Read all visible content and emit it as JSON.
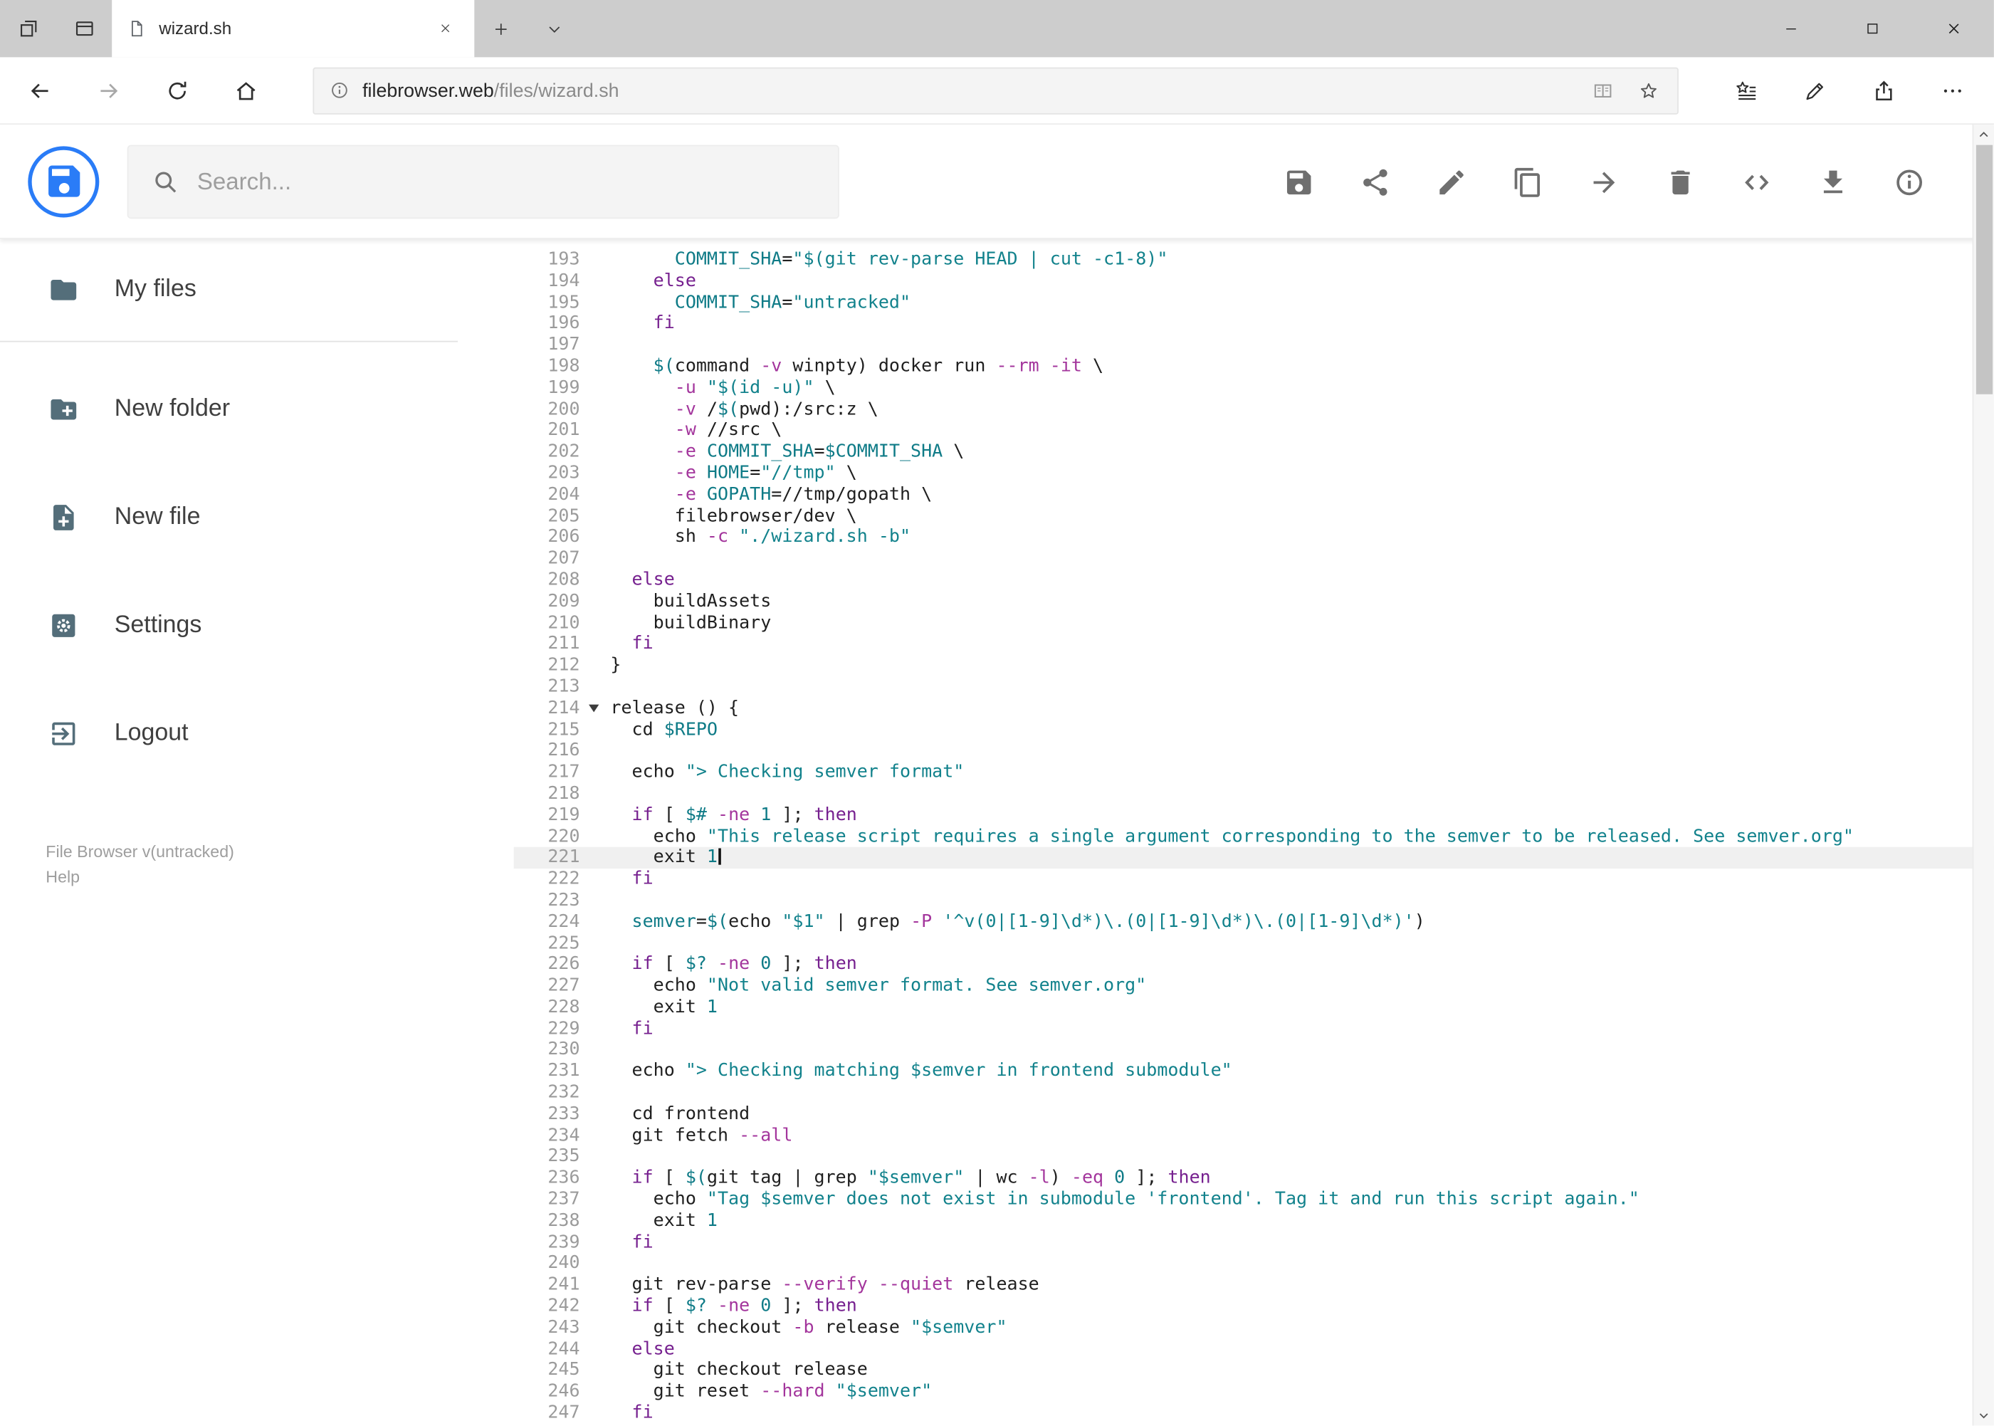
{
  "colors": {
    "accent": "#2a7cf7",
    "tabstrip_bg": "#cdcdcd",
    "active_line_bg": "#f0f0f0",
    "syntax": {
      "string": "#12828c",
      "variable": "#0f7b87",
      "keyword": "#76208f",
      "option": "#a3359c",
      "number": "#0f7b87",
      "plain": "#1f1f1f",
      "line_number": "#9b9b9b"
    }
  },
  "browser": {
    "tab_title": "wizard.sh",
    "tabstrip": {
      "left_buttons": [
        {
          "name": "set-tabs-aside",
          "icon": "tabs-aside"
        },
        {
          "name": "tabs-preview",
          "icon": "tabs-preview"
        }
      ],
      "tab_controls": [
        {
          "name": "new-tab",
          "icon": "new-tab"
        },
        {
          "name": "tab-list",
          "icon": "chevron-down"
        }
      ]
    },
    "window_controls": [
      {
        "name": "minimize",
        "icon": "minimize"
      },
      {
        "name": "maximize",
        "icon": "maximize"
      },
      {
        "name": "close-window",
        "icon": "close"
      }
    ],
    "nav": {
      "buttons": [
        {
          "name": "back",
          "icon": "back",
          "disabled": false
        },
        {
          "name": "forward",
          "icon": "forward",
          "disabled": true
        },
        {
          "name": "refresh",
          "icon": "refresh",
          "disabled": false
        },
        {
          "name": "home",
          "icon": "home",
          "disabled": false
        }
      ],
      "right_buttons": [
        {
          "name": "hub-favorites",
          "icon": "hub"
        },
        {
          "name": "web-note",
          "icon": "pen"
        },
        {
          "name": "share",
          "icon": "share-out"
        },
        {
          "name": "more-options",
          "icon": "more"
        }
      ]
    },
    "address": {
      "domain": "filebrowser.web",
      "path": "/files/wizard.sh",
      "left_icon": "info-small",
      "right_icons": [
        {
          "name": "reading-view",
          "icon": "reader",
          "dim": true
        },
        {
          "name": "add-favorite",
          "icon": "star",
          "dim": false
        }
      ]
    }
  },
  "app": {
    "search": {
      "placeholder": "Search..."
    },
    "toolbar": {
      "buttons": [
        {
          "name": "save",
          "icon": "save"
        },
        {
          "name": "share",
          "icon": "share-nodes"
        },
        {
          "name": "rename",
          "icon": "pencil"
        },
        {
          "name": "copy",
          "icon": "copy"
        },
        {
          "name": "move",
          "icon": "move"
        },
        {
          "name": "delete",
          "icon": "trash"
        },
        {
          "name": "raw-code",
          "icon": "code"
        },
        {
          "name": "download",
          "icon": "download"
        },
        {
          "name": "info",
          "icon": "info"
        }
      ]
    },
    "sidebar": {
      "items": [
        {
          "name": "my-files",
          "label": "My files",
          "icon": "folder",
          "divider_after": true
        },
        {
          "name": "new-folder",
          "label": "New folder",
          "icon": "folder-plus",
          "divider_after": false
        },
        {
          "name": "new-file",
          "label": "New file",
          "icon": "file-plus",
          "divider_after": false
        },
        {
          "name": "settings",
          "label": "Settings",
          "icon": "settings",
          "divider_after": false
        },
        {
          "name": "logout",
          "label": "Logout",
          "icon": "logout",
          "divider_after": false
        }
      ],
      "footer": {
        "version": "File Browser v(untracked)",
        "help": "Help"
      }
    },
    "editor": {
      "active_line": 221,
      "cursor_line": 221,
      "fold_marker_line": 214,
      "lines": [
        {
          "no": 193,
          "code": "      COMMIT_SHA=\"$(git rev-parse HEAD | cut -c1-8)\""
        },
        {
          "no": 194,
          "code": "    else"
        },
        {
          "no": 195,
          "code": "      COMMIT_SHA=\"untracked\""
        },
        {
          "no": 196,
          "code": "    fi"
        },
        {
          "no": 197,
          "code": ""
        },
        {
          "no": 198,
          "code": "    $(command -v winpty) docker run --rm -it \\"
        },
        {
          "no": 199,
          "code": "      -u \"$(id -u)\" \\"
        },
        {
          "no": 200,
          "code": "      -v /$(pwd):/src:z \\"
        },
        {
          "no": 201,
          "code": "      -w //src \\"
        },
        {
          "no": 202,
          "code": "      -e COMMIT_SHA=$COMMIT_SHA \\"
        },
        {
          "no": 203,
          "code": "      -e HOME=\"//tmp\" \\"
        },
        {
          "no": 204,
          "code": "      -e GOPATH=//tmp/gopath \\"
        },
        {
          "no": 205,
          "code": "      filebrowser/dev \\"
        },
        {
          "no": 206,
          "code": "      sh -c \"./wizard.sh -b\""
        },
        {
          "no": 207,
          "code": ""
        },
        {
          "no": 208,
          "code": "  else"
        },
        {
          "no": 209,
          "code": "    buildAssets"
        },
        {
          "no": 210,
          "code": "    buildBinary"
        },
        {
          "no": 211,
          "code": "  fi"
        },
        {
          "no": 212,
          "code": "}"
        },
        {
          "no": 213,
          "code": ""
        },
        {
          "no": 214,
          "code": "release () {"
        },
        {
          "no": 215,
          "code": "  cd $REPO"
        },
        {
          "no": 216,
          "code": ""
        },
        {
          "no": 217,
          "code": "  echo \"> Checking semver format\""
        },
        {
          "no": 218,
          "code": ""
        },
        {
          "no": 219,
          "code": "  if [ $# -ne 1 ]; then"
        },
        {
          "no": 220,
          "code": "    echo \"This release script requires a single argument corresponding to the semver to be released. See semver.org\""
        },
        {
          "no": 221,
          "code": "    exit 1"
        },
        {
          "no": 222,
          "code": "  fi"
        },
        {
          "no": 223,
          "code": ""
        },
        {
          "no": 224,
          "code": "  semver=$(echo \"$1\" | grep -P '^v(0|[1-9]\\d*)\\.(0|[1-9]\\d*)\\.(0|[1-9]\\d*)')"
        },
        {
          "no": 225,
          "code": ""
        },
        {
          "no": 226,
          "code": "  if [ $? -ne 0 ]; then"
        },
        {
          "no": 227,
          "code": "    echo \"Not valid semver format. See semver.org\""
        },
        {
          "no": 228,
          "code": "    exit 1"
        },
        {
          "no": 229,
          "code": "  fi"
        },
        {
          "no": 230,
          "code": ""
        },
        {
          "no": 231,
          "code": "  echo \"> Checking matching $semver in frontend submodule\""
        },
        {
          "no": 232,
          "code": ""
        },
        {
          "no": 233,
          "code": "  cd frontend"
        },
        {
          "no": 234,
          "code": "  git fetch --all"
        },
        {
          "no": 235,
          "code": ""
        },
        {
          "no": 236,
          "code": "  if [ $(git tag | grep \"$semver\" | wc -l) -eq 0 ]; then"
        },
        {
          "no": 237,
          "code": "    echo \"Tag $semver does not exist in submodule 'frontend'. Tag it and run this script again.\""
        },
        {
          "no": 238,
          "code": "    exit 1"
        },
        {
          "no": 239,
          "code": "  fi"
        },
        {
          "no": 240,
          "code": ""
        },
        {
          "no": 241,
          "code": "  git rev-parse --verify --quiet release"
        },
        {
          "no": 242,
          "code": "  if [ $? -ne 0 ]; then"
        },
        {
          "no": 243,
          "code": "    git checkout -b release \"$semver\""
        },
        {
          "no": 244,
          "code": "  else"
        },
        {
          "no": 245,
          "code": "    git checkout release"
        },
        {
          "no": 246,
          "code": "    git reset --hard \"$semver\""
        },
        {
          "no": 247,
          "code": "  fi"
        }
      ]
    }
  }
}
